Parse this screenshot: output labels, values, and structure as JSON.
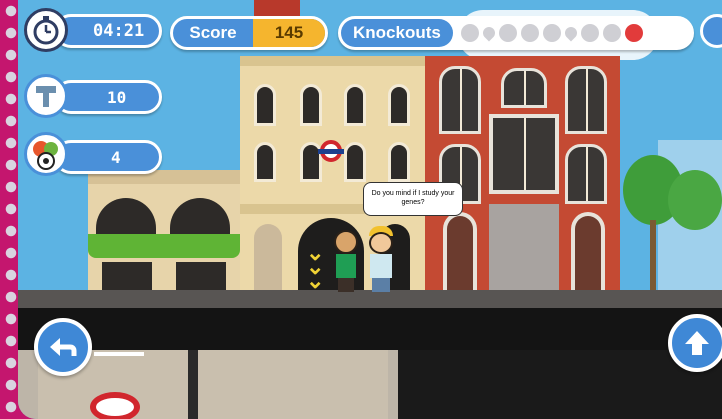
{
  "hud": {
    "timer": "04:21",
    "score_label": "Score",
    "score_value": "145",
    "knockouts_label": "Knockouts",
    "knockout_icons": [
      "heart-icon",
      "drop-icon",
      "runner-icon",
      "virus-icon",
      "circle-icon",
      "drop-icon",
      "ribbon-icon",
      "circle-icon",
      "heart-icon"
    ],
    "knockouts_active": [
      false,
      false,
      false,
      false,
      false,
      false,
      false,
      false,
      true
    ],
    "resource1_value": "10",
    "resource2_value": "4"
  },
  "speech_bubble": "Do you mind if I study your genes?",
  "colors": {
    "hud_blue": "#4a90d9",
    "score_orange": "#f5b52e",
    "frame_magenta": "#c4166e",
    "sky": "#5cb3e3"
  },
  "controls": {
    "back_icon": "back-arrow-icon",
    "up_icon": "up-arrow-icon"
  }
}
